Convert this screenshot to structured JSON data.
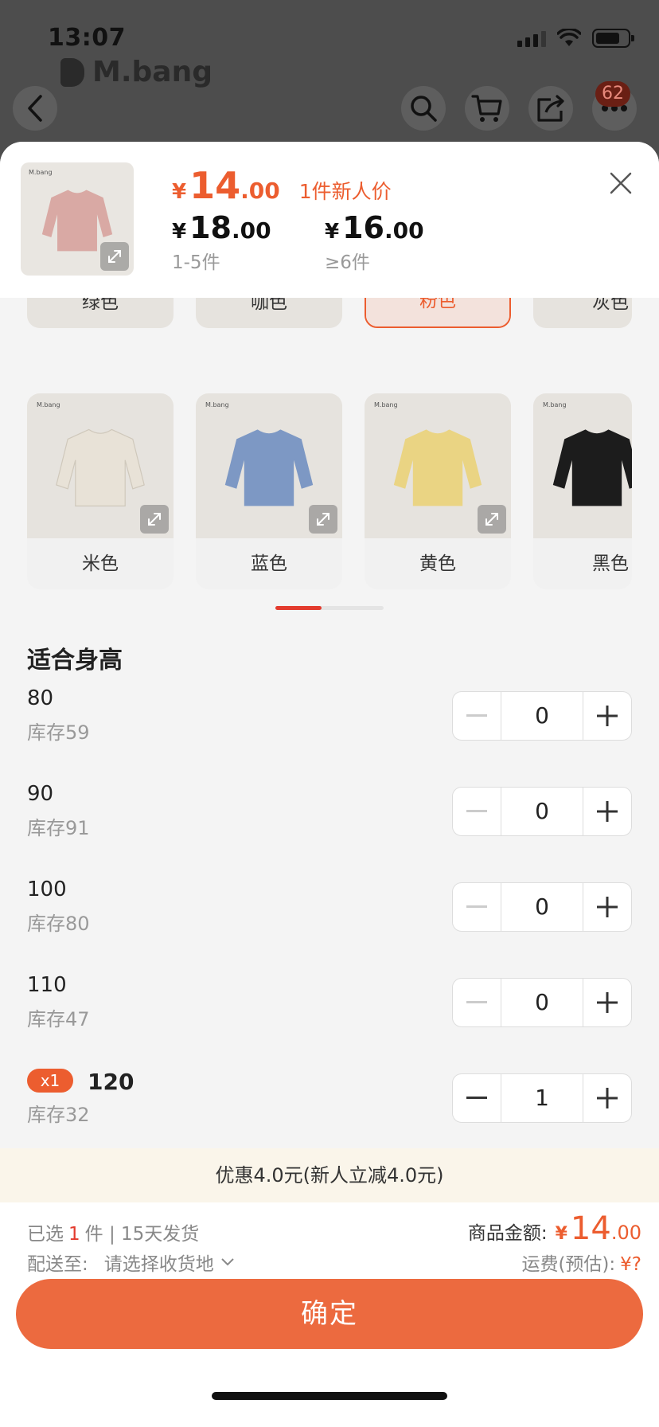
{
  "status": {
    "time": "13:07"
  },
  "app": {
    "brand": "M.bang"
  },
  "nav": {
    "badge_count": "62"
  },
  "header": {
    "price_yen": "¥",
    "price_int": "14",
    "price_dec": ".00",
    "promo_label": "1件新人价",
    "tiers": [
      {
        "yen": "¥",
        "int": "18",
        "dec": ".00",
        "label": "1-5件"
      },
      {
        "yen": "¥",
        "int": "16",
        "dec": ".00",
        "label": "≥6件"
      }
    ]
  },
  "colors": {
    "selected": "粉色",
    "row1": [
      {
        "label": "绿色"
      },
      {
        "label": "咖色"
      },
      {
        "label": "粉色"
      },
      {
        "label": "灰色"
      }
    ],
    "row2": [
      {
        "label": "米色",
        "swatch": "#e8e2d7",
        "card_logo": "M.bang"
      },
      {
        "label": "蓝色",
        "swatch": "#7d98c4",
        "card_logo": "M.bang"
      },
      {
        "label": "黄色",
        "swatch": "#ead483",
        "card_logo": "M.bang"
      },
      {
        "label": "黑色",
        "swatch": "#1c1c1c",
        "card_logo": "M.bang"
      }
    ]
  },
  "sizes": {
    "title": "适合身高",
    "items": [
      {
        "value": "80",
        "stock": "库存59",
        "qty": "0"
      },
      {
        "value": "90",
        "stock": "库存91",
        "qty": "0"
      },
      {
        "value": "100",
        "stock": "库存80",
        "qty": "0"
      },
      {
        "value": "110",
        "stock": "库存47",
        "qty": "0"
      },
      {
        "value": "120",
        "stock": "库存32",
        "qty": "1",
        "badge": "x1"
      }
    ]
  },
  "discount": "优惠4.0元(新人立减4.0元)",
  "summary": {
    "selected_prefix": "已选",
    "selected_count": "1",
    "selected_suffix": "件 | 15天发货",
    "ship_to_label": "配送至:",
    "ship_to_value": "请选择收货地",
    "amount_label": "商品金额:",
    "amount_yen": "¥",
    "amount_int": "14",
    "amount_dec": ".00",
    "shipping_label": "运费(预估):",
    "shipping_value": "¥?"
  },
  "confirm_label": "确定",
  "theme": {
    "accent": "#ec5d2f",
    "thumb_color": "#d9a9a4"
  }
}
